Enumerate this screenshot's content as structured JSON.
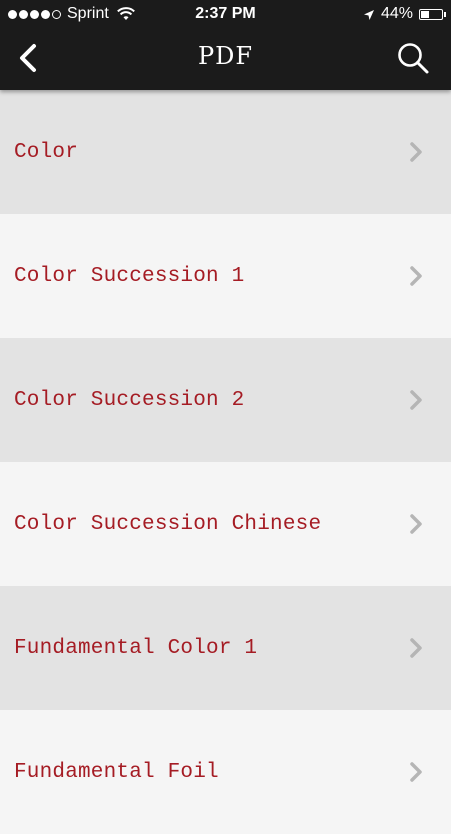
{
  "status_bar": {
    "carrier": "Sprint",
    "time": "2:37 PM",
    "battery_percent": "44%",
    "battery_level": 0.44,
    "signal_bars_filled": 4,
    "signal_bars_total": 5
  },
  "nav": {
    "title": "PDF",
    "back_icon": "chevron-left-icon",
    "search_icon": "search-icon"
  },
  "items": [
    {
      "label": "Color"
    },
    {
      "label": "Color Succession 1"
    },
    {
      "label": "Color Succession 2"
    },
    {
      "label": "Color Succession Chinese"
    },
    {
      "label": "Fundamental Color 1"
    },
    {
      "label": "Fundamental Foil"
    }
  ],
  "colors": {
    "nav_background": "#1b1b1b",
    "item_text": "#a51c24",
    "row_alt": "#e3e3e3",
    "row_plain": "#f5f5f5",
    "chevron": "#b5b5b5"
  }
}
